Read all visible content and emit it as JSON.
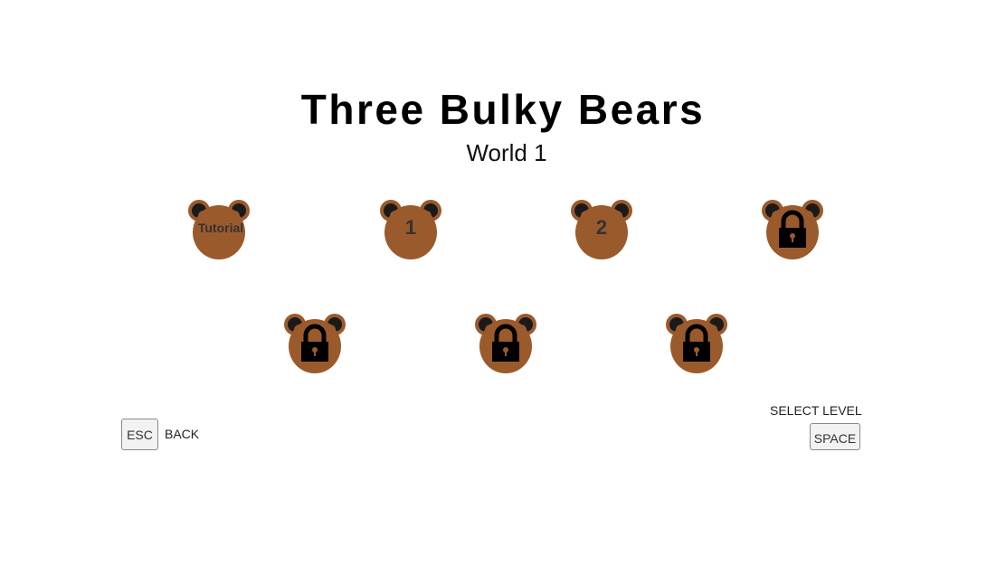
{
  "title": "Three Bulky Bears",
  "subtitle": "World 1",
  "levels": [
    {
      "label": "Tutorial",
      "locked": false
    },
    {
      "label": "1",
      "locked": false
    },
    {
      "label": "2",
      "locked": false
    },
    {
      "label": "",
      "locked": true
    },
    {
      "label": "",
      "locked": true
    },
    {
      "label": "",
      "locked": true
    },
    {
      "label": "",
      "locked": true
    }
  ],
  "controls": {
    "esc_key": "ESC",
    "back_label": "BACK",
    "select_label": "SELECT LEVEL",
    "space_key": "SPACE"
  },
  "colors": {
    "bear_face": "#9a5a2c",
    "bear_ear_inner": "#1a1a1a",
    "lock": "#000000"
  }
}
